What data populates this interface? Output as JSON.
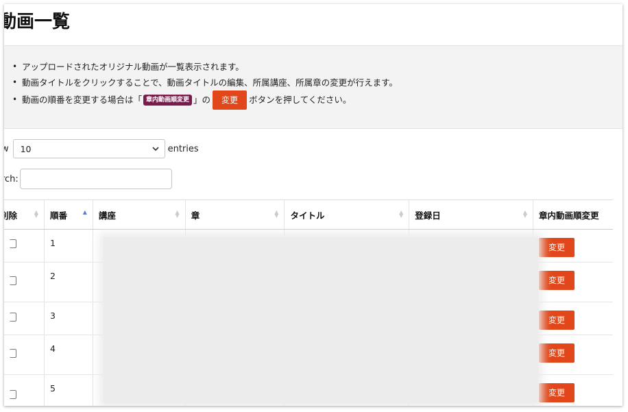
{
  "page": {
    "title": "動画一覧"
  },
  "info": {
    "bullets": [
      "アップロードされたオリジナル動画が一覧表示されます。",
      "動画タイトルをクリックすることで、動画タイトルの編集、所属講座、所属章の変更が行えます。"
    ],
    "bullet3_prefix": "動画の順番を変更する場合は「",
    "bullet3_badge": "章内動画順変更",
    "bullet3_mid": "」の",
    "bullet3_button": "変更",
    "bullet3_suffix": "ボタンを押してください。"
  },
  "length": {
    "label_prefix": "ow",
    "selected": "10",
    "label_suffix": "entries"
  },
  "search": {
    "label": "arch:",
    "value": "",
    "placeholder": ""
  },
  "table": {
    "headers": [
      "削除",
      "順番",
      "講座",
      "章",
      "タイトル",
      "登録日",
      "章内動画順変更"
    ],
    "rows": [
      {
        "order": "1",
        "button": "変更"
      },
      {
        "order": "2",
        "button": "変更"
      },
      {
        "order": "3",
        "button": "変更"
      },
      {
        "order": "4",
        "button": "変更"
      },
      {
        "order": "5",
        "button": "変更"
      }
    ]
  },
  "colors": {
    "accent": "#e1471a",
    "badge": "#7a1b4d",
    "sort_active": "#5b7bd5"
  },
  "icons": {
    "select": "chevron-down-icon",
    "sort": "sort-arrows-icon",
    "checkbox": "checkbox-icon"
  }
}
